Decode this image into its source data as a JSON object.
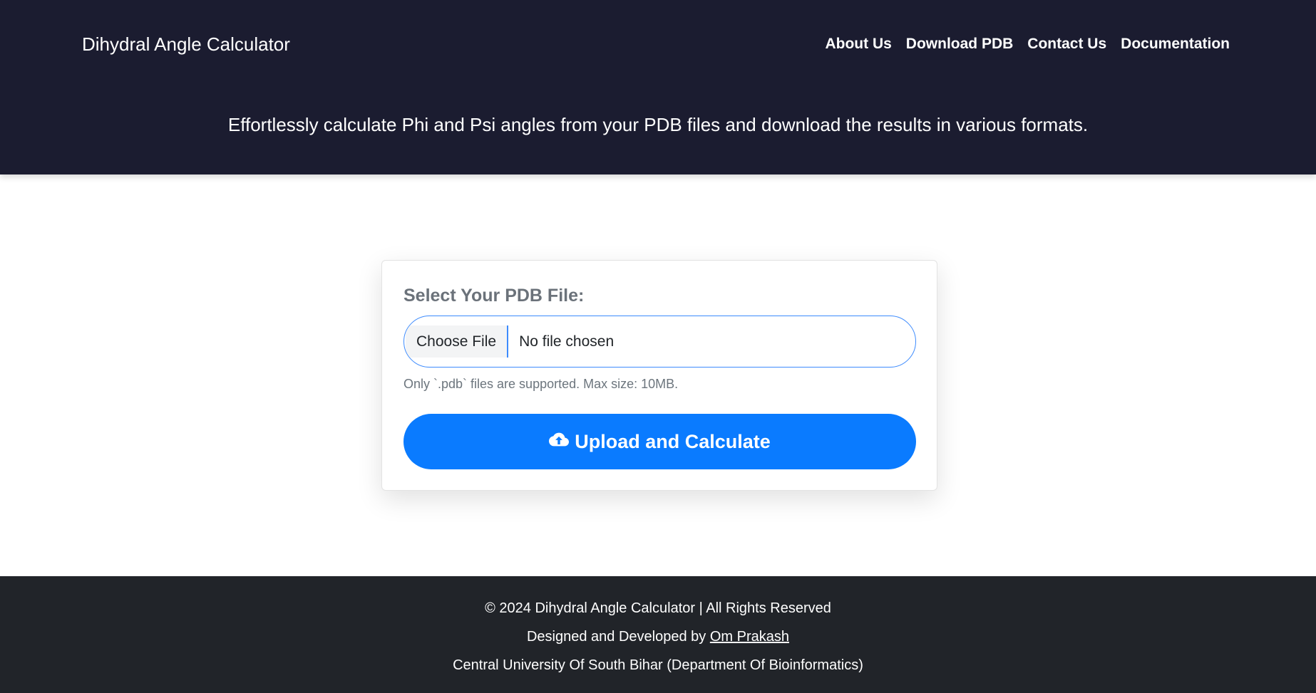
{
  "header": {
    "brand": "Dihydral Angle Calculator",
    "nav": [
      "About Us",
      "Download PDB",
      "Contact Us",
      "Documentation"
    ],
    "tagline": "Effortlessly calculate Phi and Psi angles from your PDB files and download the results in various formats."
  },
  "form": {
    "label": "Select Your PDB File:",
    "choose_file_label": "Choose File",
    "file_status": "No file chosen",
    "hint": "Only `.pdb` files are supported. Max size: 10MB.",
    "submit_label": "Upload and Calculate",
    "submit_icon": "cloud-upload-icon"
  },
  "footer": {
    "copyright": "© 2024 Dihydral Angle Calculator | All Rights Reserved",
    "designed_prefix": "Designed and Developed by ",
    "author": "Om Prakash",
    "institution": "Central University Of South Bihar (Department Of Bioinformatics)"
  },
  "colors": {
    "header_bg": "#1b1c30",
    "footer_bg": "#212429",
    "accent": "#0a7bff"
  }
}
